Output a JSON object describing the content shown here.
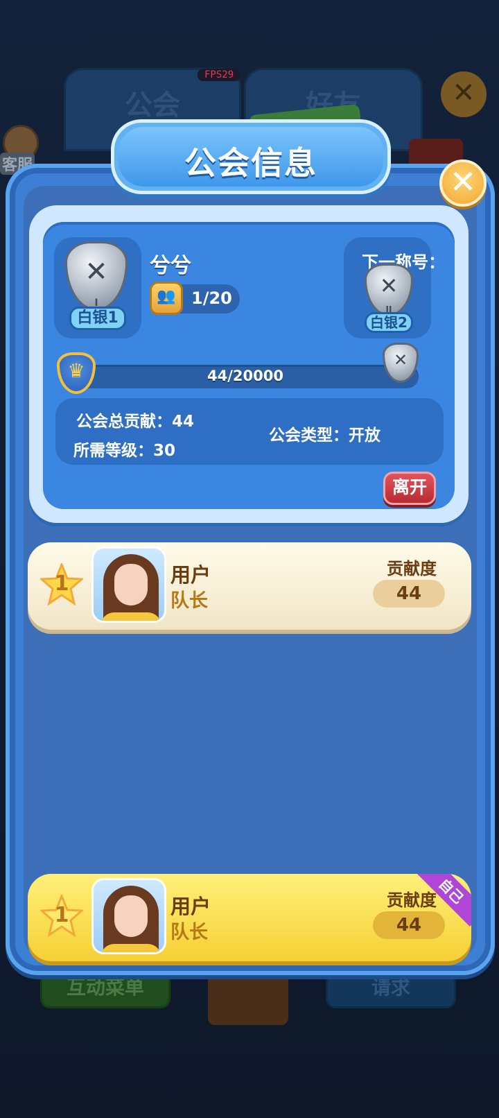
{
  "background": {
    "fps": "FPS29",
    "tab_guild": "公会",
    "tab_friends": "好友",
    "service_label": "客服",
    "bottom_left_button": "互动菜单",
    "bottom_right_button": "请求"
  },
  "dialog": {
    "title": "公会信息",
    "close_icon": "close-icon"
  },
  "guild": {
    "name": "兮兮",
    "current_rank": "白银1",
    "current_rank_numeral": "I",
    "members": "1/20",
    "next_title_label": "下一称号：",
    "next_rank": "白银2",
    "next_rank_numeral": "II",
    "progress_text": "44/20000",
    "progress_fraction": 0.0022,
    "total_contribution": "公会总贡献：44",
    "required_level": "所需等级：30",
    "guild_type": "公会类型：开放",
    "leave_button": "离开"
  },
  "members_list": [
    {
      "rank": "1",
      "name": "用户",
      "role": "队长",
      "contrib_label": "贡献度",
      "contrib_value": "44"
    }
  ],
  "self_row": {
    "rank": "1",
    "name": "用户",
    "role": "队长",
    "contrib_label": "贡献度",
    "contrib_value": "44",
    "tag": "自己"
  },
  "colors": {
    "panel": "#3d7fd4",
    "accent_gold": "#f2a530",
    "leave_red": "#c0353d",
    "self_tag": "#b046d8"
  }
}
